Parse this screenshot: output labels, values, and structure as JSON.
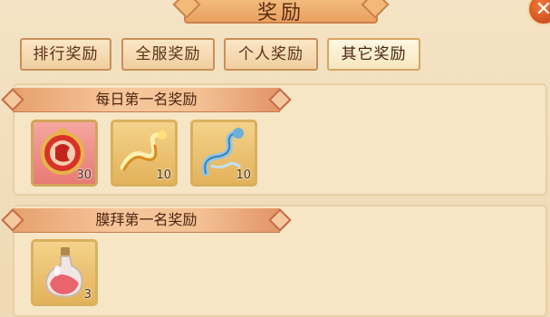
{
  "window": {
    "title": "奖励"
  },
  "tabs": [
    {
      "label": "排行奖励",
      "active": false
    },
    {
      "label": "全服奖励",
      "active": false
    },
    {
      "label": "个人奖励",
      "active": false
    },
    {
      "label": "其它奖励",
      "active": true
    }
  ],
  "sections": [
    {
      "title": "每日第一名奖励",
      "items": [
        {
          "icon": "red-amulet-icon",
          "count": "30"
        },
        {
          "icon": "golden-dragon-icon",
          "count": "10"
        },
        {
          "icon": "blue-dragon-icon",
          "count": "10"
        }
      ]
    },
    {
      "title": "膜拜第一名奖励",
      "items": [
        {
          "icon": "potion-bottle-icon",
          "count": "3"
        }
      ]
    }
  ],
  "colors": {
    "accent": "#e9a060",
    "panel": "#f4e3c4",
    "text": "#5b2d14"
  }
}
